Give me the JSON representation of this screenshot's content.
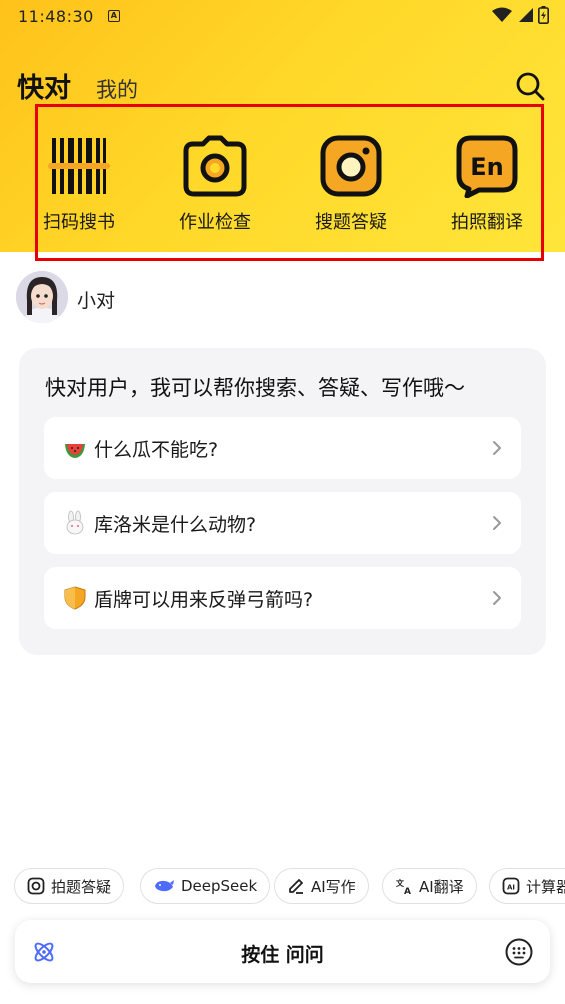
{
  "status_bar": {
    "time": "11:48:30",
    "notification_icon": "a-icon",
    "icons": [
      "wifi-icon",
      "signal-icon",
      "battery-icon"
    ]
  },
  "header": {
    "tabs": [
      {
        "label": "快对",
        "active": true
      },
      {
        "label": "我的",
        "active": false
      }
    ],
    "search_icon": "search-icon"
  },
  "tools": [
    {
      "label": "扫码搜书",
      "icon": "barcode-icon"
    },
    {
      "label": "作业检查",
      "icon": "camera-icon"
    },
    {
      "label": "搜题答疑",
      "icon": "instagram-camera-icon"
    },
    {
      "label": "拍照翻译",
      "icon": "translate-en-icon"
    }
  ],
  "assistant": {
    "name": "小对"
  },
  "chat": {
    "greeting": "快对用户，我可以帮你搜索、答疑、写作哦～",
    "suggestions": [
      {
        "emoji": "watermelon",
        "text": "什么瓜不能吃?"
      },
      {
        "emoji": "rabbit",
        "text": "库洛米是什么动物?"
      },
      {
        "emoji": "shield",
        "text": "盾牌可以用来反弹弓箭吗?"
      }
    ]
  },
  "chips": [
    {
      "label": "拍题答疑",
      "icon": "camera-icon"
    },
    {
      "label": "DeepSeek",
      "icon": "whale-icon"
    },
    {
      "label": "AI写作",
      "icon": "pen-icon"
    },
    {
      "label": "AI翻译",
      "icon": "translate-icon"
    },
    {
      "label": "计算器",
      "icon": "ai-box-icon"
    }
  ],
  "input_bar": {
    "hold_label": "按住 问问"
  },
  "colors": {
    "accent_yellow": "#ffd829",
    "highlight_red": "#e60000",
    "card_bg": "#f4f4f6",
    "icon_orange": "#f5a623"
  }
}
